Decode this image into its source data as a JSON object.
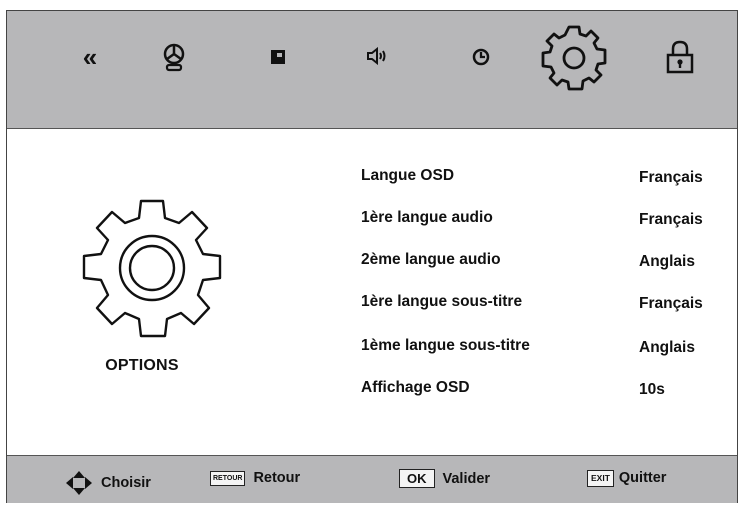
{
  "top_icons": [
    {
      "name": "back-double-chevron-icon",
      "glyph": "«"
    },
    {
      "name": "picture-icon"
    },
    {
      "name": "channel-icon"
    },
    {
      "name": "sound-icon"
    },
    {
      "name": "clock-icon"
    },
    {
      "name": "options-gear-icon",
      "selected": true
    },
    {
      "name": "lock-icon"
    }
  ],
  "panel": {
    "icon": "gear-icon",
    "title": "OPTIONS"
  },
  "menu": [
    {
      "label": "Langue OSD",
      "value": "Français"
    },
    {
      "label": "1ère langue audio",
      "value": "Français"
    },
    {
      "label": "2ème langue audio",
      "value": "Anglais"
    },
    {
      "label": "1ère langue sous-titre",
      "value": "Français"
    },
    {
      "label": "1ème langue sous-titre",
      "value": "Anglais"
    },
    {
      "label": "Affichage OSD",
      "value": "10s"
    }
  ],
  "footer": {
    "choose_label": "Choisir",
    "back_key": "RETOUR",
    "back_label": "Retour",
    "ok_key": "OK",
    "ok_label": "Valider",
    "exit_key": "EXIT",
    "exit_label": "Quitter"
  },
  "colors": {
    "bar_background": "#b7b7b9",
    "panel_background": "#ffffff",
    "text": "#111111"
  }
}
